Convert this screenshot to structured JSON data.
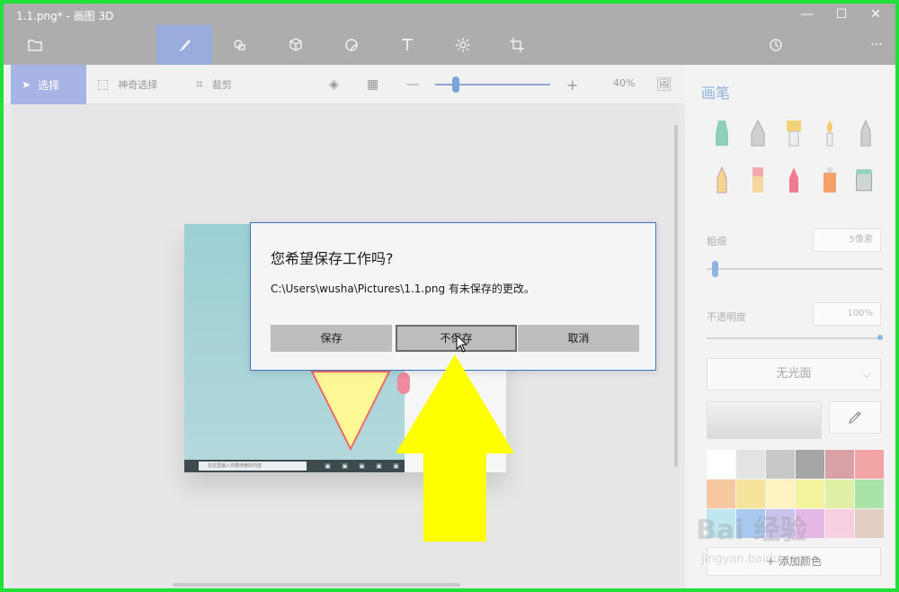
{
  "window": {
    "title": "1.1.png* - 画图 3D",
    "controls": {
      "minimize": "—",
      "maximize": "☐",
      "close": "✕"
    }
  },
  "menubar": {
    "items": [
      {
        "name": "file-menu",
        "icon": "folder-icon",
        "active": false
      },
      {
        "name": "brushes",
        "icon": "brush-icon",
        "active": true
      },
      {
        "name": "2d-shapes",
        "icon": "shapes-2d-icon",
        "active": false
      },
      {
        "name": "3d-shapes",
        "icon": "cube-icon",
        "active": false
      },
      {
        "name": "stickers",
        "icon": "sticker-icon",
        "active": false
      },
      {
        "name": "text",
        "icon": "text-icon",
        "active": false
      },
      {
        "name": "effects",
        "icon": "effects-icon",
        "active": false
      },
      {
        "name": "canvas",
        "icon": "crop-icon",
        "active": false
      },
      {
        "name": "history",
        "icon": "history-icon",
        "active": false
      },
      {
        "name": "more",
        "icon": "more-icon",
        "active": false
      }
    ],
    "more_label": "···"
  },
  "toolbar": {
    "select_label": "选择",
    "magic_select_label": "神奇选择",
    "crop_label": "裁剪",
    "zoom_minus": "—",
    "zoom_plus": "+",
    "zoom_value": "40%",
    "zoom_fraction": 0.1
  },
  "panel": {
    "title": "画笔",
    "thickness_label": "粗细",
    "thickness_value": "5像素",
    "opacity_label": "不透明度",
    "opacity_value": "100%",
    "finish_label": "无光面",
    "add_color_label": "+  添加颜色",
    "swatches": [
      "#ffffff",
      "#e3e3e3",
      "#c8c8c8",
      "#a6a6a6",
      "#d9a1a6",
      "#f2a3a3",
      "#f6c8a2",
      "#f5e29b",
      "#fff3c4",
      "#f5f49e",
      "#dff0a6",
      "#a9e3a7",
      "#bfe7f1",
      "#a9c8ef",
      "#c9c2ea",
      "#e6b8e6",
      "#f7cfe0",
      "#e3cfc2"
    ]
  },
  "image": {
    "taskbar_search": "在这里输入你要搜索的内容"
  },
  "dialog": {
    "title": "您希望保存工作吗?",
    "message": "C:\\Users\\wusha\\Pictures\\1.1.png 有未保存的更改。",
    "save_label": "保存",
    "dont_save_label": "不保存",
    "cancel_label": "取消"
  },
  "watermark": {
    "brand": "Bai 经验",
    "url": "jingyan.baidu.com"
  },
  "colors": {
    "frame": "#22e03a",
    "accent": "#3b74c3",
    "arrow": "#ffff00"
  }
}
